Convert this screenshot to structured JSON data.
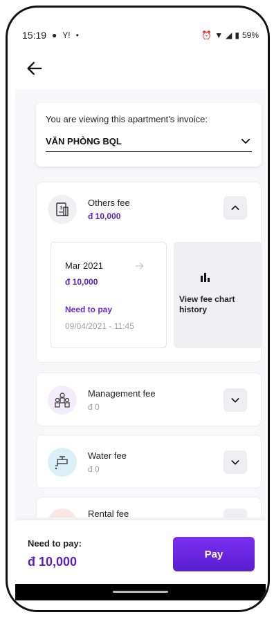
{
  "status_bar": {
    "time": "15:19",
    "battery": "59%"
  },
  "selector": {
    "label": "You are viewing this apartment's invoice:",
    "value": "VĂN PHÒNG BQL"
  },
  "fees": {
    "others": {
      "name": "Others fee",
      "amount": "đ 10,000",
      "invoice": {
        "month": "Mar 2021",
        "amount": "đ 10,000",
        "status": "Need to pay",
        "date": "09/04/2021 - 11:45"
      },
      "chart_link": "View fee chart history"
    },
    "management": {
      "name": "Management fee",
      "amount": "đ 0"
    },
    "water": {
      "name": "Water fee",
      "amount": "đ 0"
    },
    "rental": {
      "name": "Rental fee"
    }
  },
  "footer": {
    "need_to_pay_label": "Need to pay:",
    "total": "đ 10,000",
    "pay_label": "Pay"
  },
  "colors": {
    "accent": "#5b1fb8",
    "pay_button": "#6a27e0",
    "muted": "#9a9a9a"
  }
}
